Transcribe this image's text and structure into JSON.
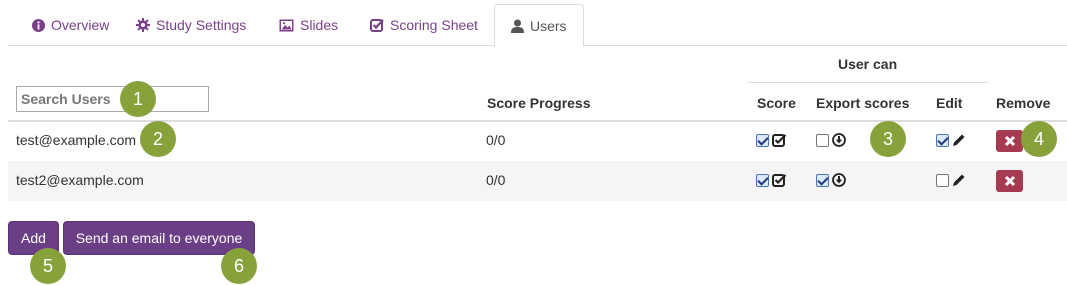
{
  "tabs": [
    {
      "label": "Overview",
      "icon": "info-circle-icon"
    },
    {
      "label": "Study Settings",
      "icon": "gear-icon"
    },
    {
      "label": "Slides",
      "icon": "picture-icon"
    },
    {
      "label": "Scoring Sheet",
      "icon": "check-square-icon"
    },
    {
      "label": "Users",
      "icon": "user-icon",
      "active": true
    }
  ],
  "table": {
    "search_placeholder": "Search Users",
    "group_header": "User can",
    "columns": {
      "score_progress": "Score Progress",
      "score": "Score",
      "export_scores": "Export scores",
      "edit": "Edit",
      "remove": "Remove"
    },
    "rows": [
      {
        "email": "test@example.com",
        "progress": "0/0",
        "can_score": true,
        "can_export": false,
        "can_edit": true
      },
      {
        "email": "test2@example.com",
        "progress": "0/0",
        "can_score": true,
        "can_export": true,
        "can_edit": false
      }
    ]
  },
  "buttons": {
    "add": "Add",
    "email_everyone": "Send an email to everyone"
  },
  "callouts": [
    "1",
    "2",
    "3",
    "4",
    "5",
    "6"
  ],
  "colors": {
    "brand_purple": "#6b3f86",
    "tab_link": "#7b3f8a",
    "remove_red": "#a63a50",
    "callout_green": "#87a23a"
  }
}
